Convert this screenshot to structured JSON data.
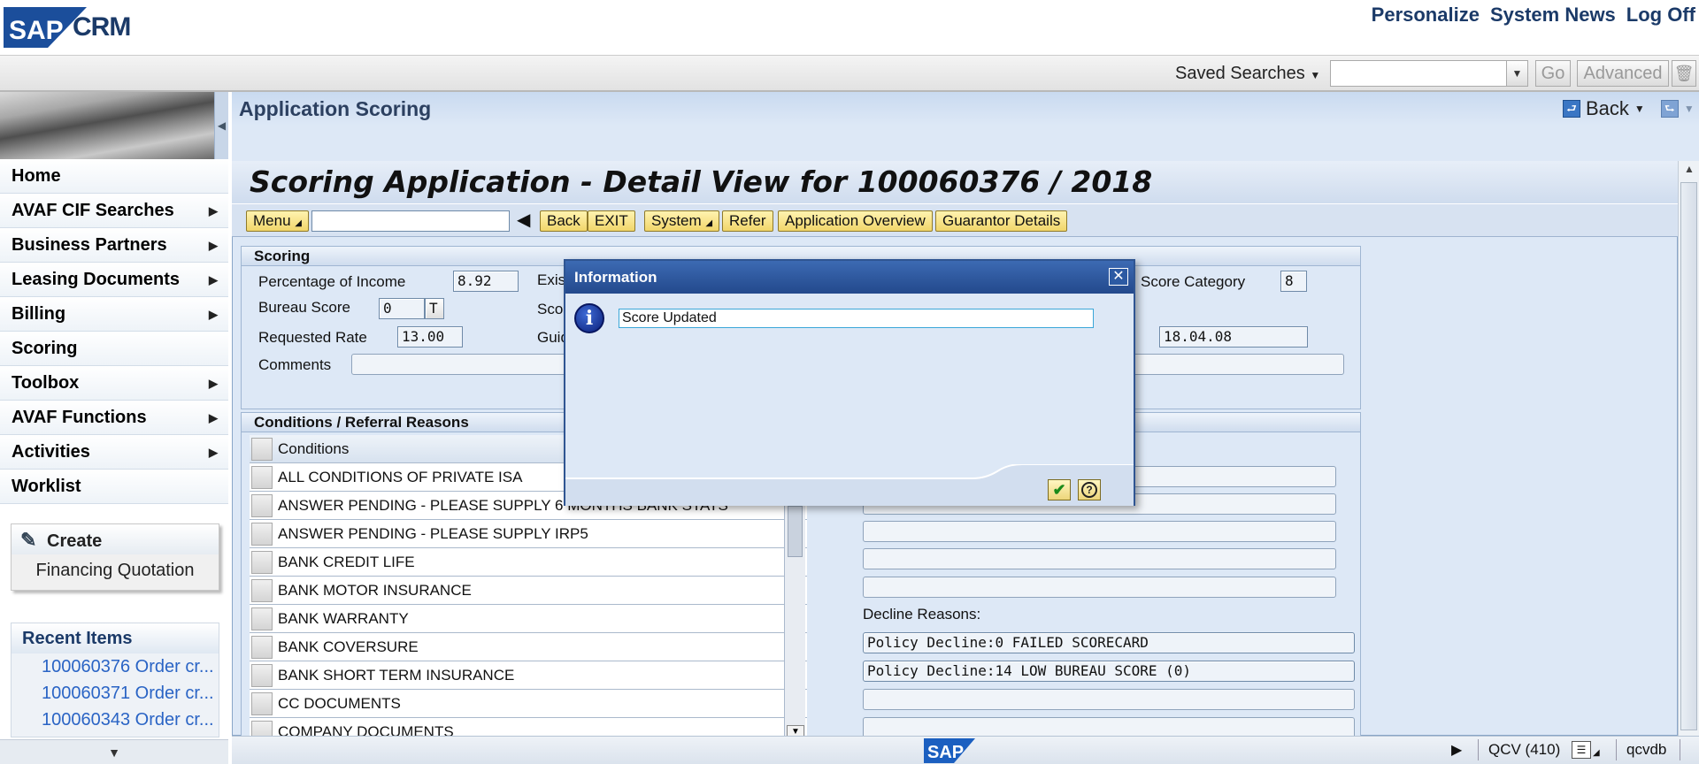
{
  "header": {
    "logo_text": "SAP CRM",
    "links": [
      "Personalize",
      "System News",
      "Log Off"
    ]
  },
  "search": {
    "saved_label": "Saved Searches",
    "input_value": "",
    "go_label": "Go",
    "advanced_label": "Advanced"
  },
  "nav": {
    "items": [
      {
        "label": "Home",
        "arrow": false
      },
      {
        "label": "AVAF CIF Searches",
        "arrow": true
      },
      {
        "label": "Business Partners",
        "arrow": true
      },
      {
        "label": "Leasing Documents",
        "arrow": true
      },
      {
        "label": "Billing",
        "arrow": true
      },
      {
        "label": "Scoring",
        "arrow": false
      },
      {
        "label": "Toolbox",
        "arrow": true
      },
      {
        "label": "AVAF Functions",
        "arrow": true
      },
      {
        "label": "Activities",
        "arrow": true
      },
      {
        "label": "Worklist",
        "arrow": false
      }
    ],
    "create": {
      "title": "Create",
      "sub": "Financing Quotation"
    },
    "recent": {
      "title": "Recent Items",
      "items": [
        "100060376 Order cr...",
        "100060371 Order cr...",
        "100060343 Order cr..."
      ]
    }
  },
  "page": {
    "title": "Application Scoring",
    "back_label": "Back"
  },
  "gui": {
    "title": "Scoring Application - Detail View for 100060376 / 2018",
    "toolbar": {
      "menu": "Menu",
      "command_value": "",
      "buttons": [
        "Back",
        "EXIT",
        "System",
        "Refer",
        "Application Overview",
        "Guarantor Details"
      ]
    },
    "scoring": {
      "title": "Scoring",
      "pct_income_label": "Percentage of Income",
      "pct_income_value": "8.92",
      "exis_label": "Exis",
      "bureau_label": "Bureau Score",
      "bureau_value": "0",
      "bureau_flag": "T",
      "sco_label": "Sco",
      "req_rate_label": "Requested Rate",
      "req_rate_value": "13.00",
      "guid_label": "Guid",
      "comments_label": "Comments",
      "score_category_label": "Score Category",
      "score_category_value": "8",
      "date_value": "18.04.08"
    },
    "conditions": {
      "title": "Conditions / Referral Reasons",
      "column": "Conditions",
      "rows": [
        "ALL CONDITIONS OF PRIVATE ISA",
        "ANSWER PENDING - PLEASE SUPPLY 6 MONTHS BANK STATS",
        "ANSWER PENDING - PLEASE SUPPLY IRP5",
        "BANK CREDIT LIFE",
        "BANK MOTOR INSURANCE",
        "BANK WARRANTY",
        "BANK COVERSURE",
        "BANK SHORT TERM INSURANCE",
        "CC DOCUMENTS",
        "COMPANY DOCUMENTS"
      ],
      "decline_label": "Decline Reasons:",
      "decline_values": [
        "Policy Decline:0 FAILED SCORECARD",
        "Policy Decline:14 LOW BUREAU SCORE (0)"
      ]
    }
  },
  "dialog": {
    "title": "Information",
    "message": "Score Updated"
  },
  "status": {
    "system": "QCV (410)",
    "host": "qcvdb"
  }
}
